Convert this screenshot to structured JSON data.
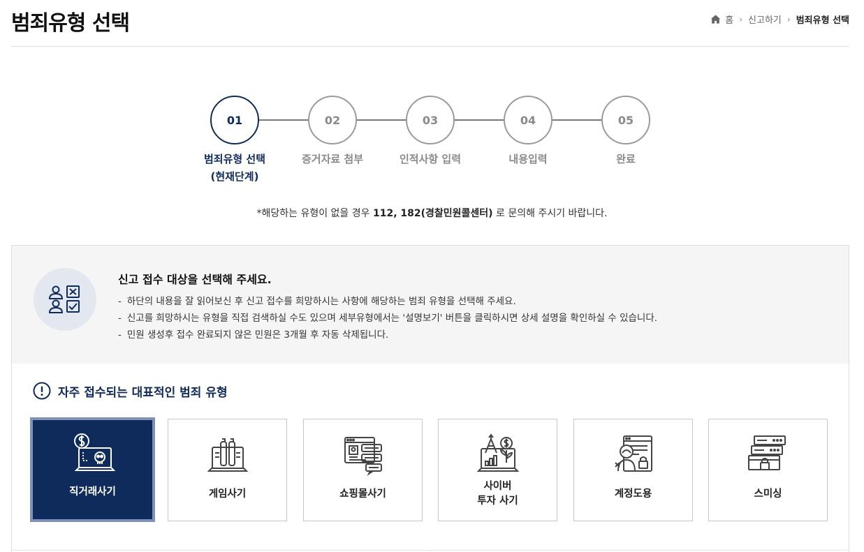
{
  "header": {
    "title": "범죄유형 선택",
    "breadcrumb": [
      {
        "label": "홈"
      },
      {
        "label": "신고하기"
      },
      {
        "label": "범죄유형 선택"
      }
    ]
  },
  "steps": [
    {
      "num": "01",
      "label": "범죄유형 선택",
      "sublabel": "(현재단계)",
      "active": true
    },
    {
      "num": "02",
      "label": "증거자료 첨부",
      "active": false
    },
    {
      "num": "03",
      "label": "인적사항 입력",
      "active": false
    },
    {
      "num": "04",
      "label": "내용입력",
      "active": false
    },
    {
      "num": "05",
      "label": "완료",
      "active": false
    }
  ],
  "notice": {
    "prefix": "*해당하는 유형이 없을 경우 ",
    "bold": "112, 182(경찰민원콜센터)",
    "suffix": " 로 문의해 주시기 바랍니다."
  },
  "guide": {
    "icon": "checklist-people-icon",
    "title": "신고 접수 대상을 선택해 주세요.",
    "items": [
      "하단의 내용을 잘 읽어보신 후 신고 접수를 희망하시는 사항에 해당하는 범죄 유형을 선택해 주세요.",
      "신고를 희망하시는 유형을 직접 검색하실 수도 있으며 세부유형에서는 '설명보기' 버튼을 클릭하시면 상세 설명을 확인하실 수 있습니다.",
      "민원 생성후 접수 완료되지 않은 민원은 3개월 후 자동 삭제됩니다."
    ]
  },
  "frequent": {
    "icon": "alert-icon",
    "title": "자주 접수되는 대표적인 범죄 유형",
    "cards": [
      {
        "label": "직거래사기",
        "icon": "direct-trade-fraud-icon",
        "selected": true
      },
      {
        "label": "게임사기",
        "icon": "game-fraud-icon",
        "selected": false
      },
      {
        "label": "쇼핑몰사기",
        "icon": "shopping-mall-fraud-icon",
        "selected": false
      },
      {
        "label": "사이버\n투자 사기",
        "icon": "cyber-investment-fraud-icon",
        "selected": false
      },
      {
        "label": "계정도용",
        "icon": "account-theft-icon",
        "selected": false
      },
      {
        "label": "스미싱",
        "icon": "smishing-icon",
        "selected": false
      }
    ]
  },
  "colors": {
    "primary": "#0f2b5b",
    "selected_border": "#7f92b5",
    "inactive": "#8a8a8a",
    "panel_bg": "#f5f5f5"
  }
}
